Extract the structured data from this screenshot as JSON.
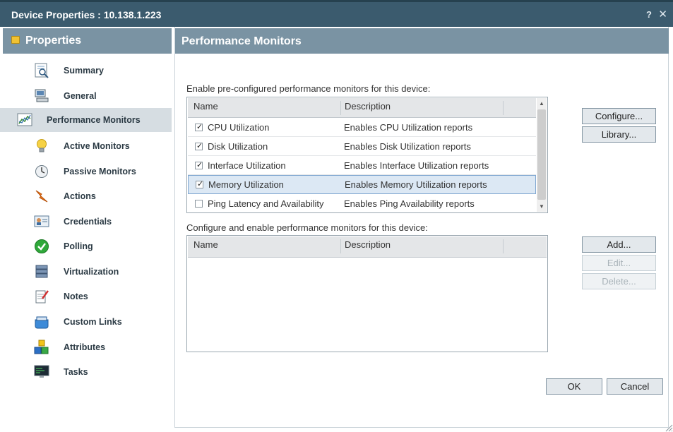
{
  "window": {
    "title": "Device Properties : 10.138.1.223",
    "help_label": "?",
    "close_label": "✕"
  },
  "sidebar": {
    "header": "Properties",
    "items": [
      {
        "label": "Summary",
        "icon": "summary-icon"
      },
      {
        "label": "General",
        "icon": "computer-icon"
      },
      {
        "label": "Performance Monitors",
        "icon": "chart-icon",
        "active": true
      },
      {
        "label": "Active Monitors",
        "icon": "lightbulb-icon"
      },
      {
        "label": "Passive Monitors",
        "icon": "clock-icon"
      },
      {
        "label": "Actions",
        "icon": "lightning-icon"
      },
      {
        "label": "Credentials",
        "icon": "id-card-icon"
      },
      {
        "label": "Polling",
        "icon": "check-circle-icon"
      },
      {
        "label": "Virtualization",
        "icon": "server-stack-icon"
      },
      {
        "label": "Notes",
        "icon": "notepad-icon"
      },
      {
        "label": "Custom Links",
        "icon": "links-icon"
      },
      {
        "label": "Attributes",
        "icon": "blocks-icon"
      },
      {
        "label": "Tasks",
        "icon": "monitor-icon"
      }
    ]
  },
  "panel": {
    "title": "Performance Monitors",
    "preconfigured": {
      "label": "Enable pre-configured performance monitors for this device:",
      "columns": [
        "Name",
        "Description"
      ],
      "rows": [
        {
          "name": "CPU Utilization",
          "description": "Enables CPU Utilization reports",
          "checked": true
        },
        {
          "name": "Disk Utilization",
          "description": "Enables Disk Utilization reports",
          "checked": true
        },
        {
          "name": "Interface Utilization",
          "description": "Enables Interface Utilization reports",
          "checked": true
        },
        {
          "name": "Memory Utilization",
          "description": "Enables Memory Utilization reports",
          "checked": true,
          "selected": true
        },
        {
          "name": "Ping Latency and Availability",
          "description": "Enables Ping Availability reports",
          "checked": false
        }
      ],
      "configure_button": "Configure...",
      "library_button": "Library..."
    },
    "custom": {
      "label": "Configure and enable performance monitors for this device:",
      "columns": [
        "Name",
        "Description"
      ],
      "add_button": "Add...",
      "edit_button": "Edit...",
      "delete_button": "Delete..."
    },
    "ok_button": "OK",
    "cancel_button": "Cancel"
  },
  "colors": {
    "titlebar": "#3b5b6e",
    "section_header": "#7a93a3",
    "selected_row": "#dce8f4",
    "active_nav": "#d6dde2"
  }
}
